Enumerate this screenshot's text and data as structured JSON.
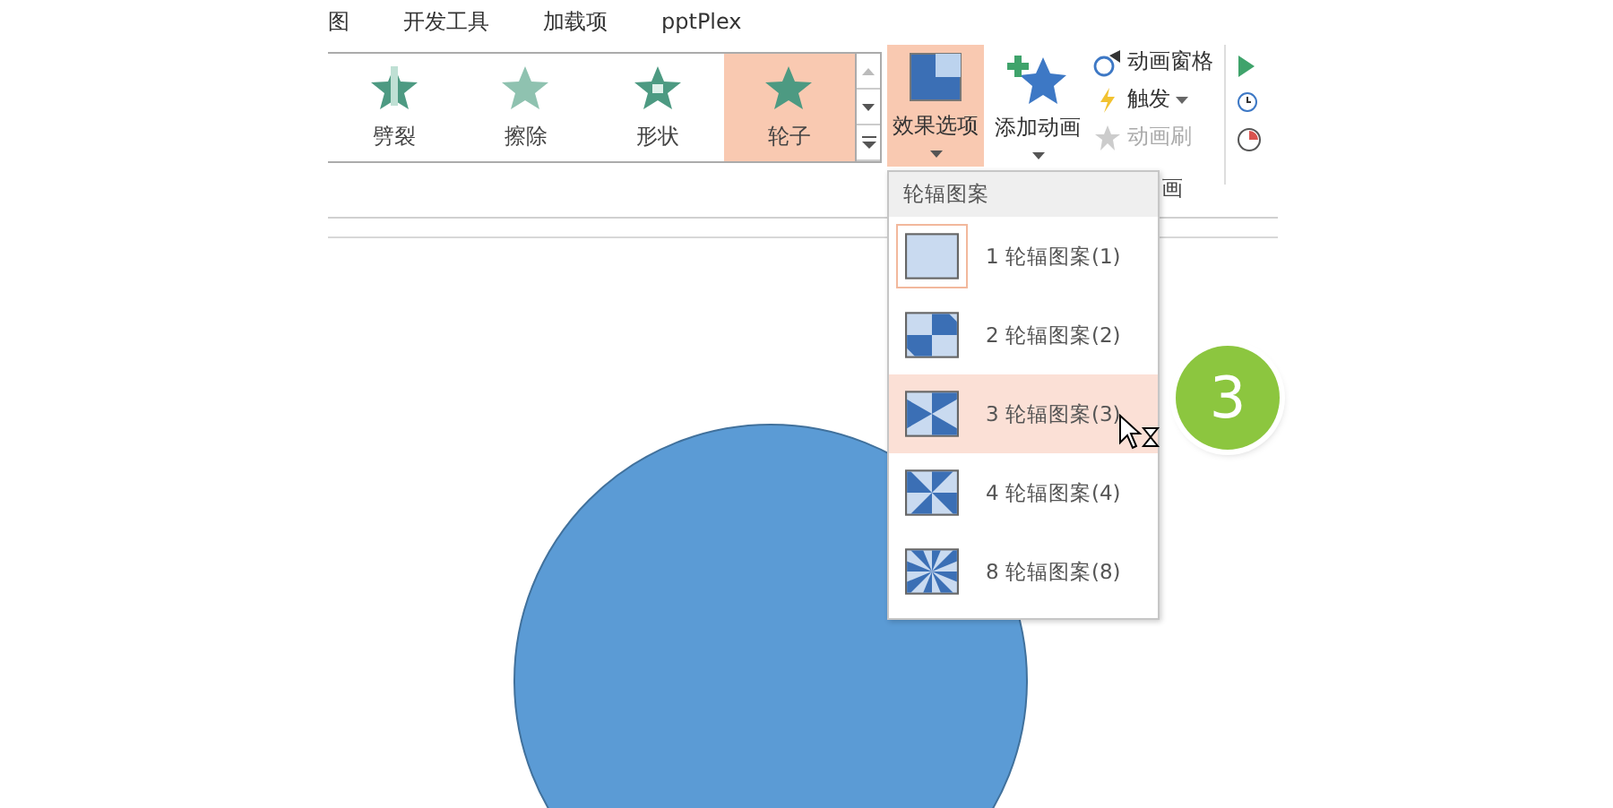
{
  "menu_tabs": [
    {
      "label": "图"
    },
    {
      "label": "开发工具"
    },
    {
      "label": "加载项"
    },
    {
      "label": "pptPlex"
    }
  ],
  "gallery": [
    {
      "label": "劈裂",
      "selected": false,
      "kind": "split"
    },
    {
      "label": "擦除",
      "selected": false,
      "kind": "wipe"
    },
    {
      "label": "形状",
      "selected": false,
      "kind": "shape"
    },
    {
      "label": "轮子",
      "selected": true,
      "kind": "wheel"
    }
  ],
  "effect_options": {
    "label": "效果选项",
    "selected": true
  },
  "add_animation": {
    "label": "添加动画"
  },
  "small_buttons": [
    {
      "label": "动画窗格",
      "kind": "pane",
      "disabled": false,
      "dropdown": false
    },
    {
      "label": "触发",
      "kind": "trigger",
      "disabled": false,
      "dropdown": true
    },
    {
      "label": "动画刷",
      "kind": "painter",
      "disabled": true,
      "dropdown": false
    }
  ],
  "group_label": "画",
  "dropdown": {
    "header": "轮辐图案",
    "items": [
      {
        "label": "1 轮辐图案(1)",
        "kind": "one",
        "selected": true,
        "hovered": false
      },
      {
        "label": "2 轮辐图案(2)",
        "kind": "two",
        "selected": false,
        "hovered": false
      },
      {
        "label": "3 轮辐图案(3)",
        "kind": "three",
        "selected": false,
        "hovered": true
      },
      {
        "label": "4 轮辐图案(4)",
        "kind": "four",
        "selected": false,
        "hovered": false
      },
      {
        "label": "8 轮辐图案(8)",
        "kind": "eight",
        "selected": false,
        "hovered": false
      }
    ]
  },
  "step_badge": "3"
}
